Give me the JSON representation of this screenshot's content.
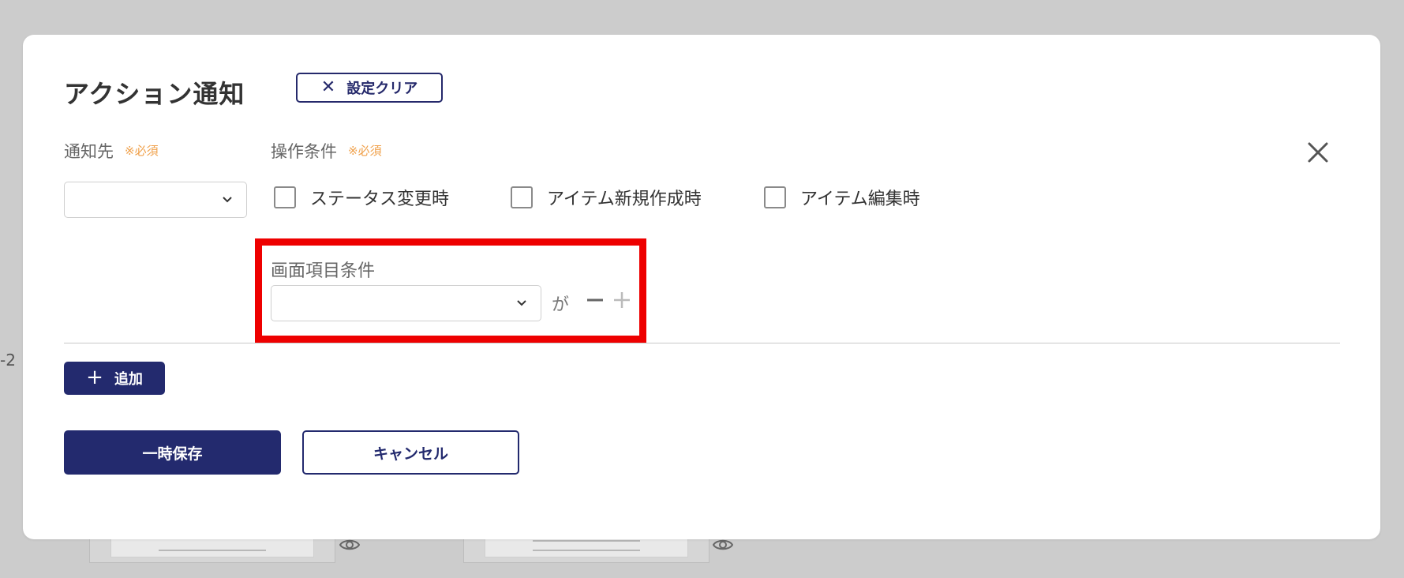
{
  "background": {
    "side_text": "-2"
  },
  "modal": {
    "title": "アクション通知",
    "clear_button_label": "設定クリア",
    "notify_to": {
      "label": "通知先",
      "required": "※必須",
      "selected_value": ""
    },
    "operation_conditions": {
      "label": "操作条件",
      "required": "※必須",
      "options": [
        {
          "label": "ステータス変更時",
          "checked": false
        },
        {
          "label": "アイテム新規作成時",
          "checked": false
        },
        {
          "label": "アイテム編集時",
          "checked": false
        }
      ]
    },
    "screen_item_condition": {
      "label": "画面項目条件",
      "selected_value": "",
      "suffix": "が"
    },
    "add_button_label": "追加",
    "save_button_label": "一時保存",
    "cancel_button_label": "キャンセル"
  },
  "colors": {
    "primary": "#232a6e",
    "required_text": "#f0a04a",
    "highlight": "#ee0000",
    "overlay": "#cccccc"
  },
  "icons": {
    "close": "close-icon",
    "chevron": "chevron-down-icon",
    "minus": "minus-icon",
    "plus": "plus-icon",
    "eye": "eye-icon"
  }
}
